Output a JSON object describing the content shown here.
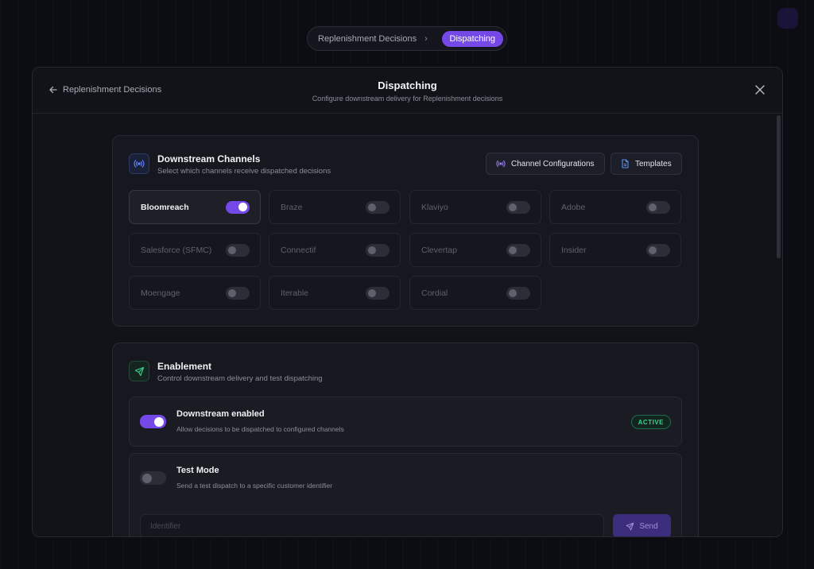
{
  "breadcrumb": {
    "parent": "Replenishment Decisions",
    "separator": "›",
    "current": "Dispatching"
  },
  "modal": {
    "back_label": "Replenishment Decisions",
    "title": "Dispatching",
    "subtitle": "Configure downstream delivery for Replenishment decisions"
  },
  "channels_section": {
    "title": "Downstream Channels",
    "description": "Select which channels receive dispatched decisions",
    "config_button": "Channel Configurations",
    "templates_button": "Templates",
    "icon": "broadcast-icon",
    "channels": [
      {
        "name": "Bloomreach",
        "enabled": true
      },
      {
        "name": "Braze",
        "enabled": false
      },
      {
        "name": "Klaviyo",
        "enabled": false
      },
      {
        "name": "Adobe",
        "enabled": false
      },
      {
        "name": "Salesforce (SFMC)",
        "enabled": false
      },
      {
        "name": "Connectif",
        "enabled": false
      },
      {
        "name": "Clevertap",
        "enabled": false
      },
      {
        "name": "Insider",
        "enabled": false
      },
      {
        "name": "Moengage",
        "enabled": false
      },
      {
        "name": "Iterable",
        "enabled": false
      },
      {
        "name": "Cordial",
        "enabled": false
      }
    ]
  },
  "enablement_section": {
    "title": "Enablement",
    "description": "Control downstream delivery and test dispatching",
    "icon": "send-icon",
    "downstream": {
      "title": "Downstream enabled",
      "description": "Allow decisions to be dispatched to configured channels",
      "enabled": true,
      "badge": "ACTIVE"
    },
    "test_mode": {
      "title": "Test Mode",
      "description": "Send a test dispatch to a specific customer identifier",
      "enabled": false,
      "input_placeholder": "Identifier",
      "send_label": "Send"
    }
  },
  "colors": {
    "accent": "#7548e8",
    "success": "#3fd08f",
    "background": "#0c0d12"
  }
}
